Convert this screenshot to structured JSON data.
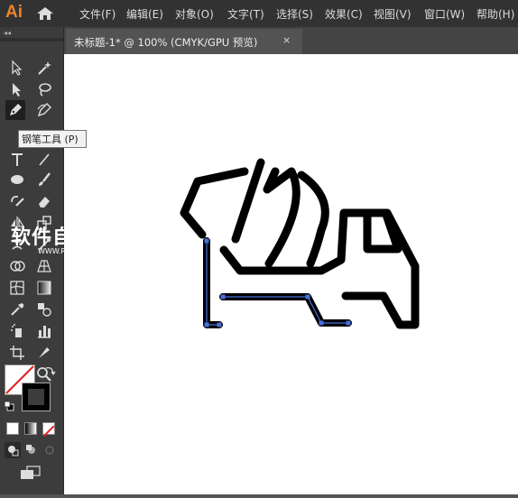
{
  "app": {
    "logo": "Ai"
  },
  "menu": {
    "items": [
      "文件(F)",
      "编辑(E)",
      "对象(O)",
      "文字(T)",
      "选择(S)",
      "效果(C)",
      "视图(V)",
      "窗口(W)",
      "帮助(H)"
    ]
  },
  "toolbar": {
    "collapse_label": "◂◂"
  },
  "document_tab": {
    "title": "未标题-1* @ 100% (CMYK/GPU 预览)",
    "close_label": "×"
  },
  "tooltip": {
    "text": "钢笔工具 (P)"
  },
  "watermark": {
    "main": "软件自学网",
    "sub": "WWW.RJZXW.COM"
  },
  "colors": {
    "stroke": "#000000",
    "path_selection": "#4a6fd8",
    "logo": "#e8852e",
    "none_swatch_slash": "#e02020"
  }
}
